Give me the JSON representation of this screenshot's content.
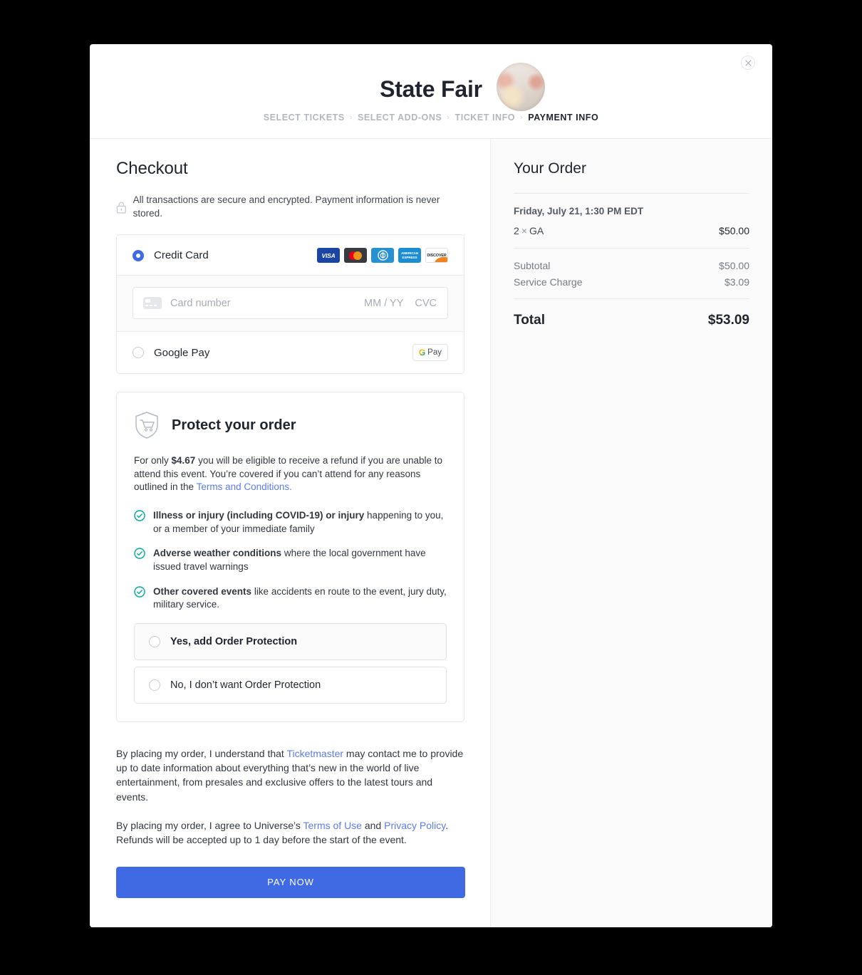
{
  "header": {
    "event_title": "State Fair",
    "avatar_alt": "event-avatar",
    "close_label": "×",
    "breadcrumb": [
      {
        "label": "SELECT TICKETS",
        "active": false
      },
      {
        "label": "SELECT ADD-ONS",
        "active": false
      },
      {
        "label": "TICKET INFO",
        "active": false
      },
      {
        "label": "PAYMENT INFO",
        "active": true
      }
    ],
    "separator": "›"
  },
  "checkout": {
    "title": "Checkout",
    "security_notice": "All transactions are secure and encrypted. Payment information is never stored.",
    "lock_icon": "lock-icon"
  },
  "payment_methods": {
    "credit_card": {
      "label": "Credit Card",
      "selected": true,
      "brands": [
        {
          "name": "VISA",
          "id": "visa"
        },
        {
          "name": "Mastercard",
          "id": "mastercard"
        },
        {
          "name": "Diners Club",
          "id": "diners"
        },
        {
          "name": "AMERICAN EXPRESS",
          "id": "amex"
        },
        {
          "name": "DISCOVER",
          "id": "discover"
        }
      ]
    },
    "card_field": {
      "card_icon": "credit-card-icon",
      "number_placeholder": "Card number",
      "number_value": "",
      "expiry_placeholder": "MM / YY",
      "expiry_value": "",
      "cvc_placeholder": "CVC",
      "cvc_value": ""
    },
    "google_pay": {
      "label": "Google Pay",
      "selected": false,
      "badge_g": "G",
      "badge_pay": "Pay"
    }
  },
  "protect": {
    "icon": "shield-cart-icon",
    "title": "Protect your order",
    "desc_pre": "For only ",
    "price": "$4.67",
    "desc_mid": " you will be eligible to receive a refund if you are unable to attend this event. You’re covered if you can’t attend for any reasons outlined in the ",
    "terms_link": "Terms and Conditions.",
    "benefits": [
      {
        "bold": "Illness or injury (including COVID-19) or injury",
        "rest": " happening to you, or a member of your immediate family"
      },
      {
        "bold": "Adverse weather conditions",
        "rest": " where the local government have issued travel warnings"
      },
      {
        "bold": "Other covered events",
        "rest": " like accidents en route to the event, jury duty, military service."
      }
    ],
    "options": [
      {
        "label": "Yes, add Order Protection",
        "selected": false
      },
      {
        "label": "No, I don’t want Order Protection",
        "selected": false
      }
    ]
  },
  "legal": {
    "para1_pre": "By placing my order, I understand that ",
    "ticketmaster_link": "Ticketmaster",
    "para1_post": " may contact me to provide up to date information about everything that’s new in the world of live entertainment, from presales and exclusive offers to the latest tours and events.",
    "para2_pre": "By placing my order, I agree to Universe’s ",
    "terms_link": "Terms of Use",
    "para2_and": " and ",
    "privacy_link": "Privacy Policy",
    "para2_post": ". Refunds will be accepted up to 1 day before the start of the event."
  },
  "pay_button": {
    "label": "PAY NOW"
  },
  "order": {
    "title": "Your Order",
    "date": "Friday, July 21, 1:30 PM EDT",
    "items": [
      {
        "qty": "2",
        "multiplier": "×",
        "name": "GA",
        "amount": "$50.00"
      }
    ],
    "fees": [
      {
        "label": "Subtotal",
        "amount": "$50.00"
      },
      {
        "label": "Service Charge",
        "amount": "$3.09"
      }
    ],
    "total_label": "Total",
    "total_amount": "$53.09"
  },
  "colors": {
    "accent_blue": "#3f6ae3",
    "link_blue": "#5b7cea",
    "check_teal": "#00a99d",
    "page_bg": "#000000",
    "panel_bg": "#fafafa"
  }
}
